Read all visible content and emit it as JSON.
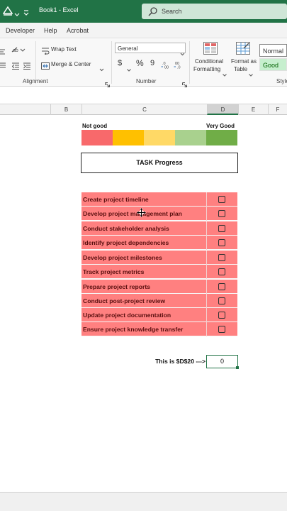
{
  "titlebar": {
    "title": "Book1 - Excel",
    "search_placeholder": "Search"
  },
  "tabs": [
    "Developer",
    "Help",
    "Acrobat"
  ],
  "ribbon": {
    "alignment": {
      "wrap_text": "Wrap Text",
      "merge_center": "Merge & Center",
      "group_label": "Alignment"
    },
    "number": {
      "format_value": "General",
      "currency_symbol": "$",
      "percent_symbol": "%",
      "comma_symbol": "9",
      "inc_decimal": ".00",
      "dec_decimal": ".00",
      "group_label": "Number"
    },
    "styles": {
      "conditional_formatting_line1": "Conditional",
      "conditional_formatting_line2": "Formatting",
      "format_as_table_line1": "Format as",
      "format_as_table_line2": "Table",
      "normal": "Normal",
      "good": "Good",
      "group_label": "Style"
    }
  },
  "columns": [
    "B",
    "C",
    "D",
    "E",
    "F"
  ],
  "scale": {
    "left_label": "Not good",
    "right_label": "Very Good",
    "colors": [
      "#f8696b",
      "#ffc000",
      "#ffd966",
      "#a9d18e",
      "#70ad47"
    ]
  },
  "task_header": "TASK Progress",
  "tasks": [
    "Create project timeline",
    "Develop project management plan",
    "Conduct stakeholder analysis",
    "Identify project dependencies",
    "Develop project milestones",
    "Track project metrics",
    "Prepare project reports",
    "Conduct post-project review",
    "Update project documentation",
    "Ensure project knowledge transfer"
  ],
  "formula_label": "This is $D$20 --->",
  "result_value": "0",
  "colors": {
    "excel_green": "#217346",
    "task_fill": "#ff8080"
  }
}
